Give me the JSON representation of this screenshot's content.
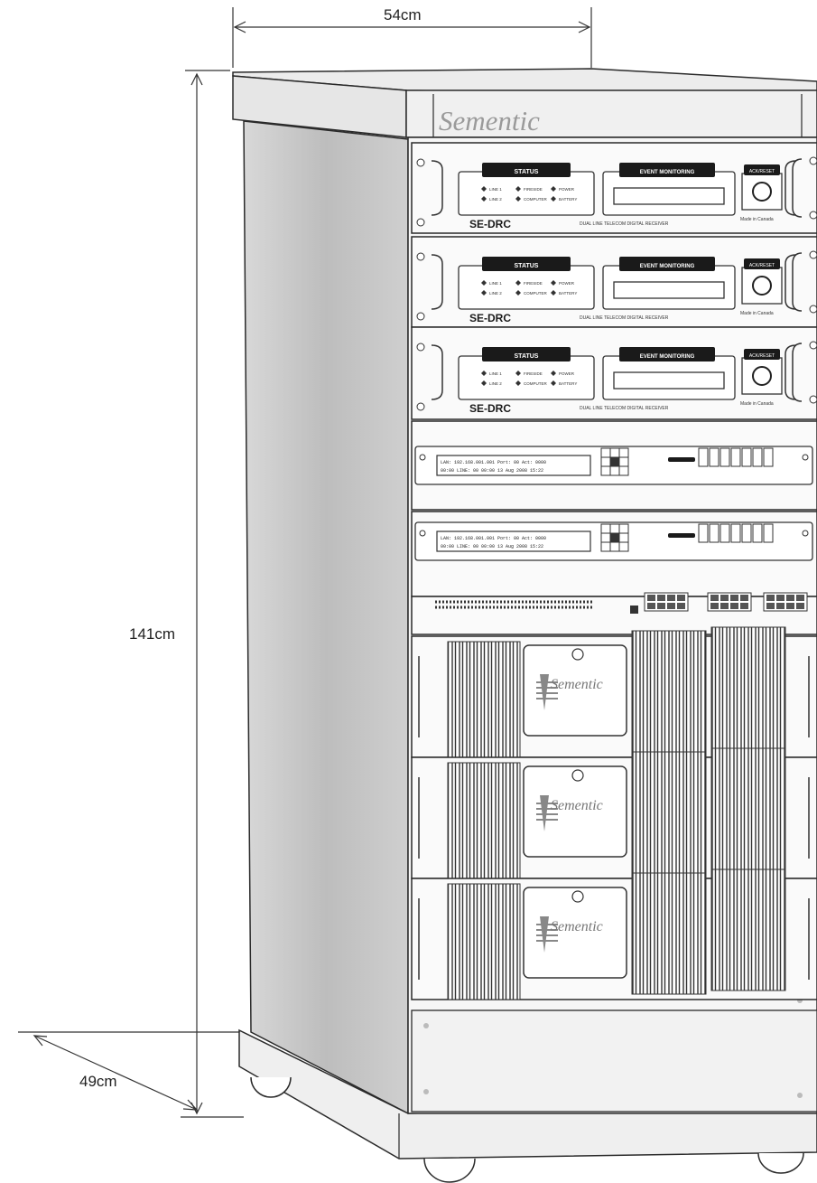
{
  "dimensions": {
    "width": "54cm",
    "height": "141cm",
    "depth": "49cm"
  },
  "cabinet": {
    "brand": "Sementic"
  },
  "receivers": [
    {
      "model": "SE-DRC",
      "description": "DUAL LINE TELECOM DIGITAL RECEIVER",
      "status_title": "STATUS",
      "status_leds": [
        "LINE 1",
        "FIRESIDE",
        "POWER",
        "LINE 2",
        "COMPUTER",
        "BATTERY"
      ],
      "monitor_title": "EVENT MONITORING",
      "ack_title": "ACK/RESET",
      "origin": "Made in Canada"
    },
    {
      "model": "SE-DRC",
      "description": "DUAL LINE TELECOM DIGITAL RECEIVER",
      "status_title": "STATUS",
      "status_leds": [
        "LINE 1",
        "FIRESIDE",
        "POWER",
        "LINE 2",
        "COMPUTER",
        "BATTERY"
      ],
      "monitor_title": "EVENT MONITORING",
      "ack_title": "ACK/RESET",
      "origin": "Made in Canada"
    },
    {
      "model": "SE-DRC",
      "description": "DUAL LINE TELECOM DIGITAL RECEIVER",
      "status_title": "STATUS",
      "status_leds": [
        "LINE 1",
        "FIRESIDE",
        "POWER",
        "LINE 2",
        "COMPUTER",
        "BATTERY"
      ],
      "monitor_title": "EVENT MONITORING",
      "ack_title": "ACK/RESET",
      "origin": "Made in Canada"
    }
  ],
  "switches": [
    {
      "line1": "LAN: 192.168.001.001  Port: 00  Act: 0000",
      "line2": "00:00  LINE: 00  00:00    13 Aug 2008   15:22"
    },
    {
      "line1": "LAN: 192.168.001.001  Port: 00  Act: 0000",
      "line2": "00:00  LINE: 00  00:00    13 Aug 2008   15:22"
    }
  ],
  "ups_units": [
    {
      "brand": "Sementic"
    },
    {
      "brand": "Sementic"
    },
    {
      "brand": "Sementic"
    }
  ],
  "colors": {
    "line": "#2a2a2a",
    "side_panel": "#b8b8b8",
    "front": "#f4f4f4",
    "label_dark": "#1a1a1a"
  }
}
